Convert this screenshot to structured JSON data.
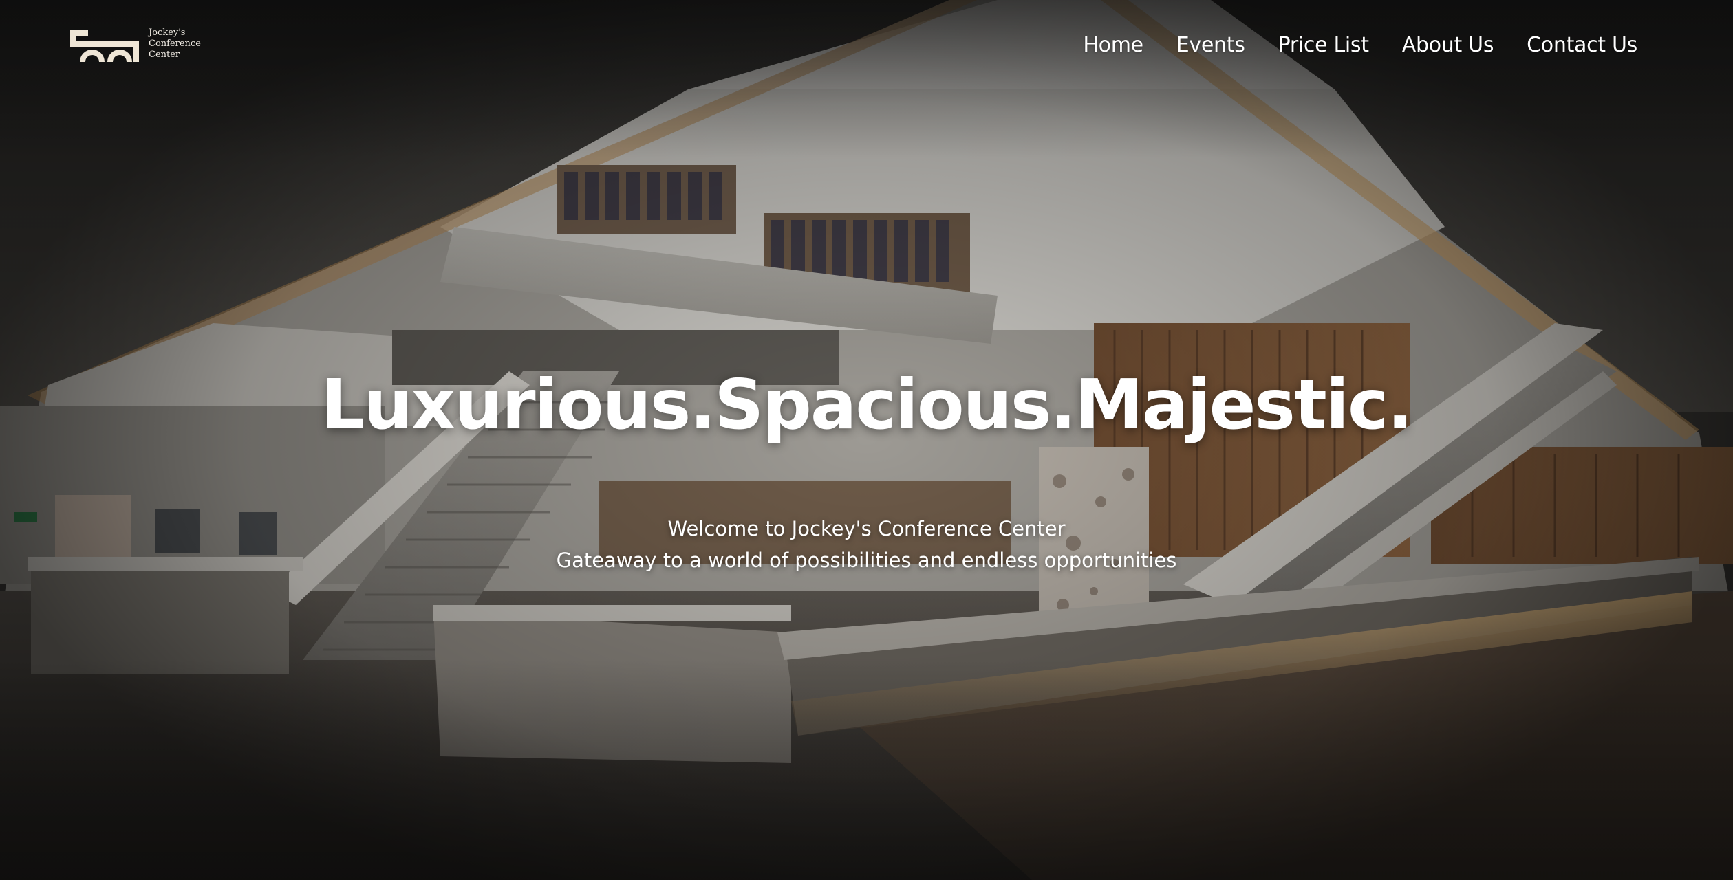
{
  "brand": {
    "name_line1": "Jockey's",
    "name_line2": "Conference",
    "name_line3": "Center",
    "logo_icon": "linked-rings-logo-icon",
    "logo_color": "#efe6d6"
  },
  "nav": {
    "items": [
      {
        "label": "Home"
      },
      {
        "label": "Events"
      },
      {
        "label": "Price List"
      },
      {
        "label": "About Us"
      },
      {
        "label": "Contact Us"
      }
    ]
  },
  "hero": {
    "title": "Luxurious.Spacious.Majestic.",
    "subtitle_line1": "Welcome to Jockey's Conference Center",
    "subtitle_line2": "Gateaway to a world of possibilities and endless opportunities",
    "background_image": "atrium-staircases-photo"
  },
  "colors": {
    "text": "#ffffff",
    "accent": "#efe6d6"
  }
}
